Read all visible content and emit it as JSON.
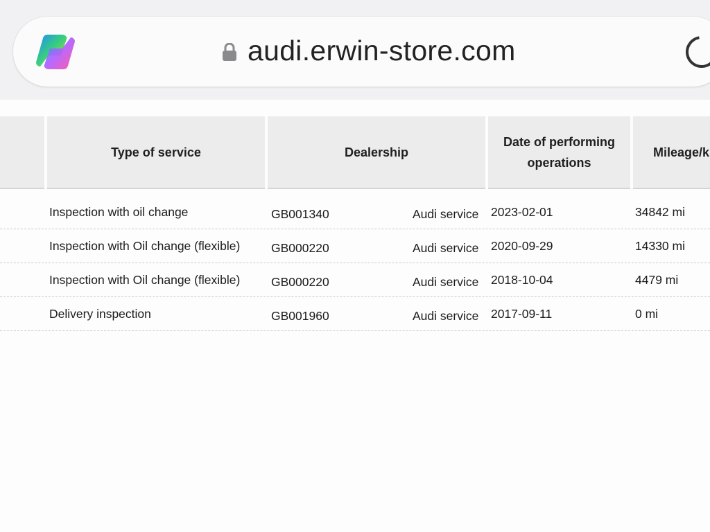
{
  "browser": {
    "url": "audi.erwin-store.com"
  },
  "table": {
    "headers": {
      "type": "Type of service",
      "dealership": "Dealership",
      "date_line1": "Date of performing",
      "date_line2": "operations",
      "mileage": "Mileage/k"
    },
    "rows": [
      {
        "type": "Inspection with oil change",
        "code": "GB001340",
        "service": "Audi service",
        "date": "2023-02-01",
        "mileage": "34842 mi"
      },
      {
        "type": "Inspection with Oil change (flexible)",
        "code": "GB000220",
        "service": "Audi service",
        "date": "2020-09-29",
        "mileage": "14330 mi"
      },
      {
        "type": "Inspection with Oil change (flexible)",
        "code": "GB000220",
        "service": "Audi service",
        "date": "2018-10-04",
        "mileage": "4479 mi"
      },
      {
        "type": "Delivery inspection",
        "code": "GB001960",
        "service": "Audi service",
        "date": "2017-09-11",
        "mileage": "0 mi"
      }
    ]
  }
}
